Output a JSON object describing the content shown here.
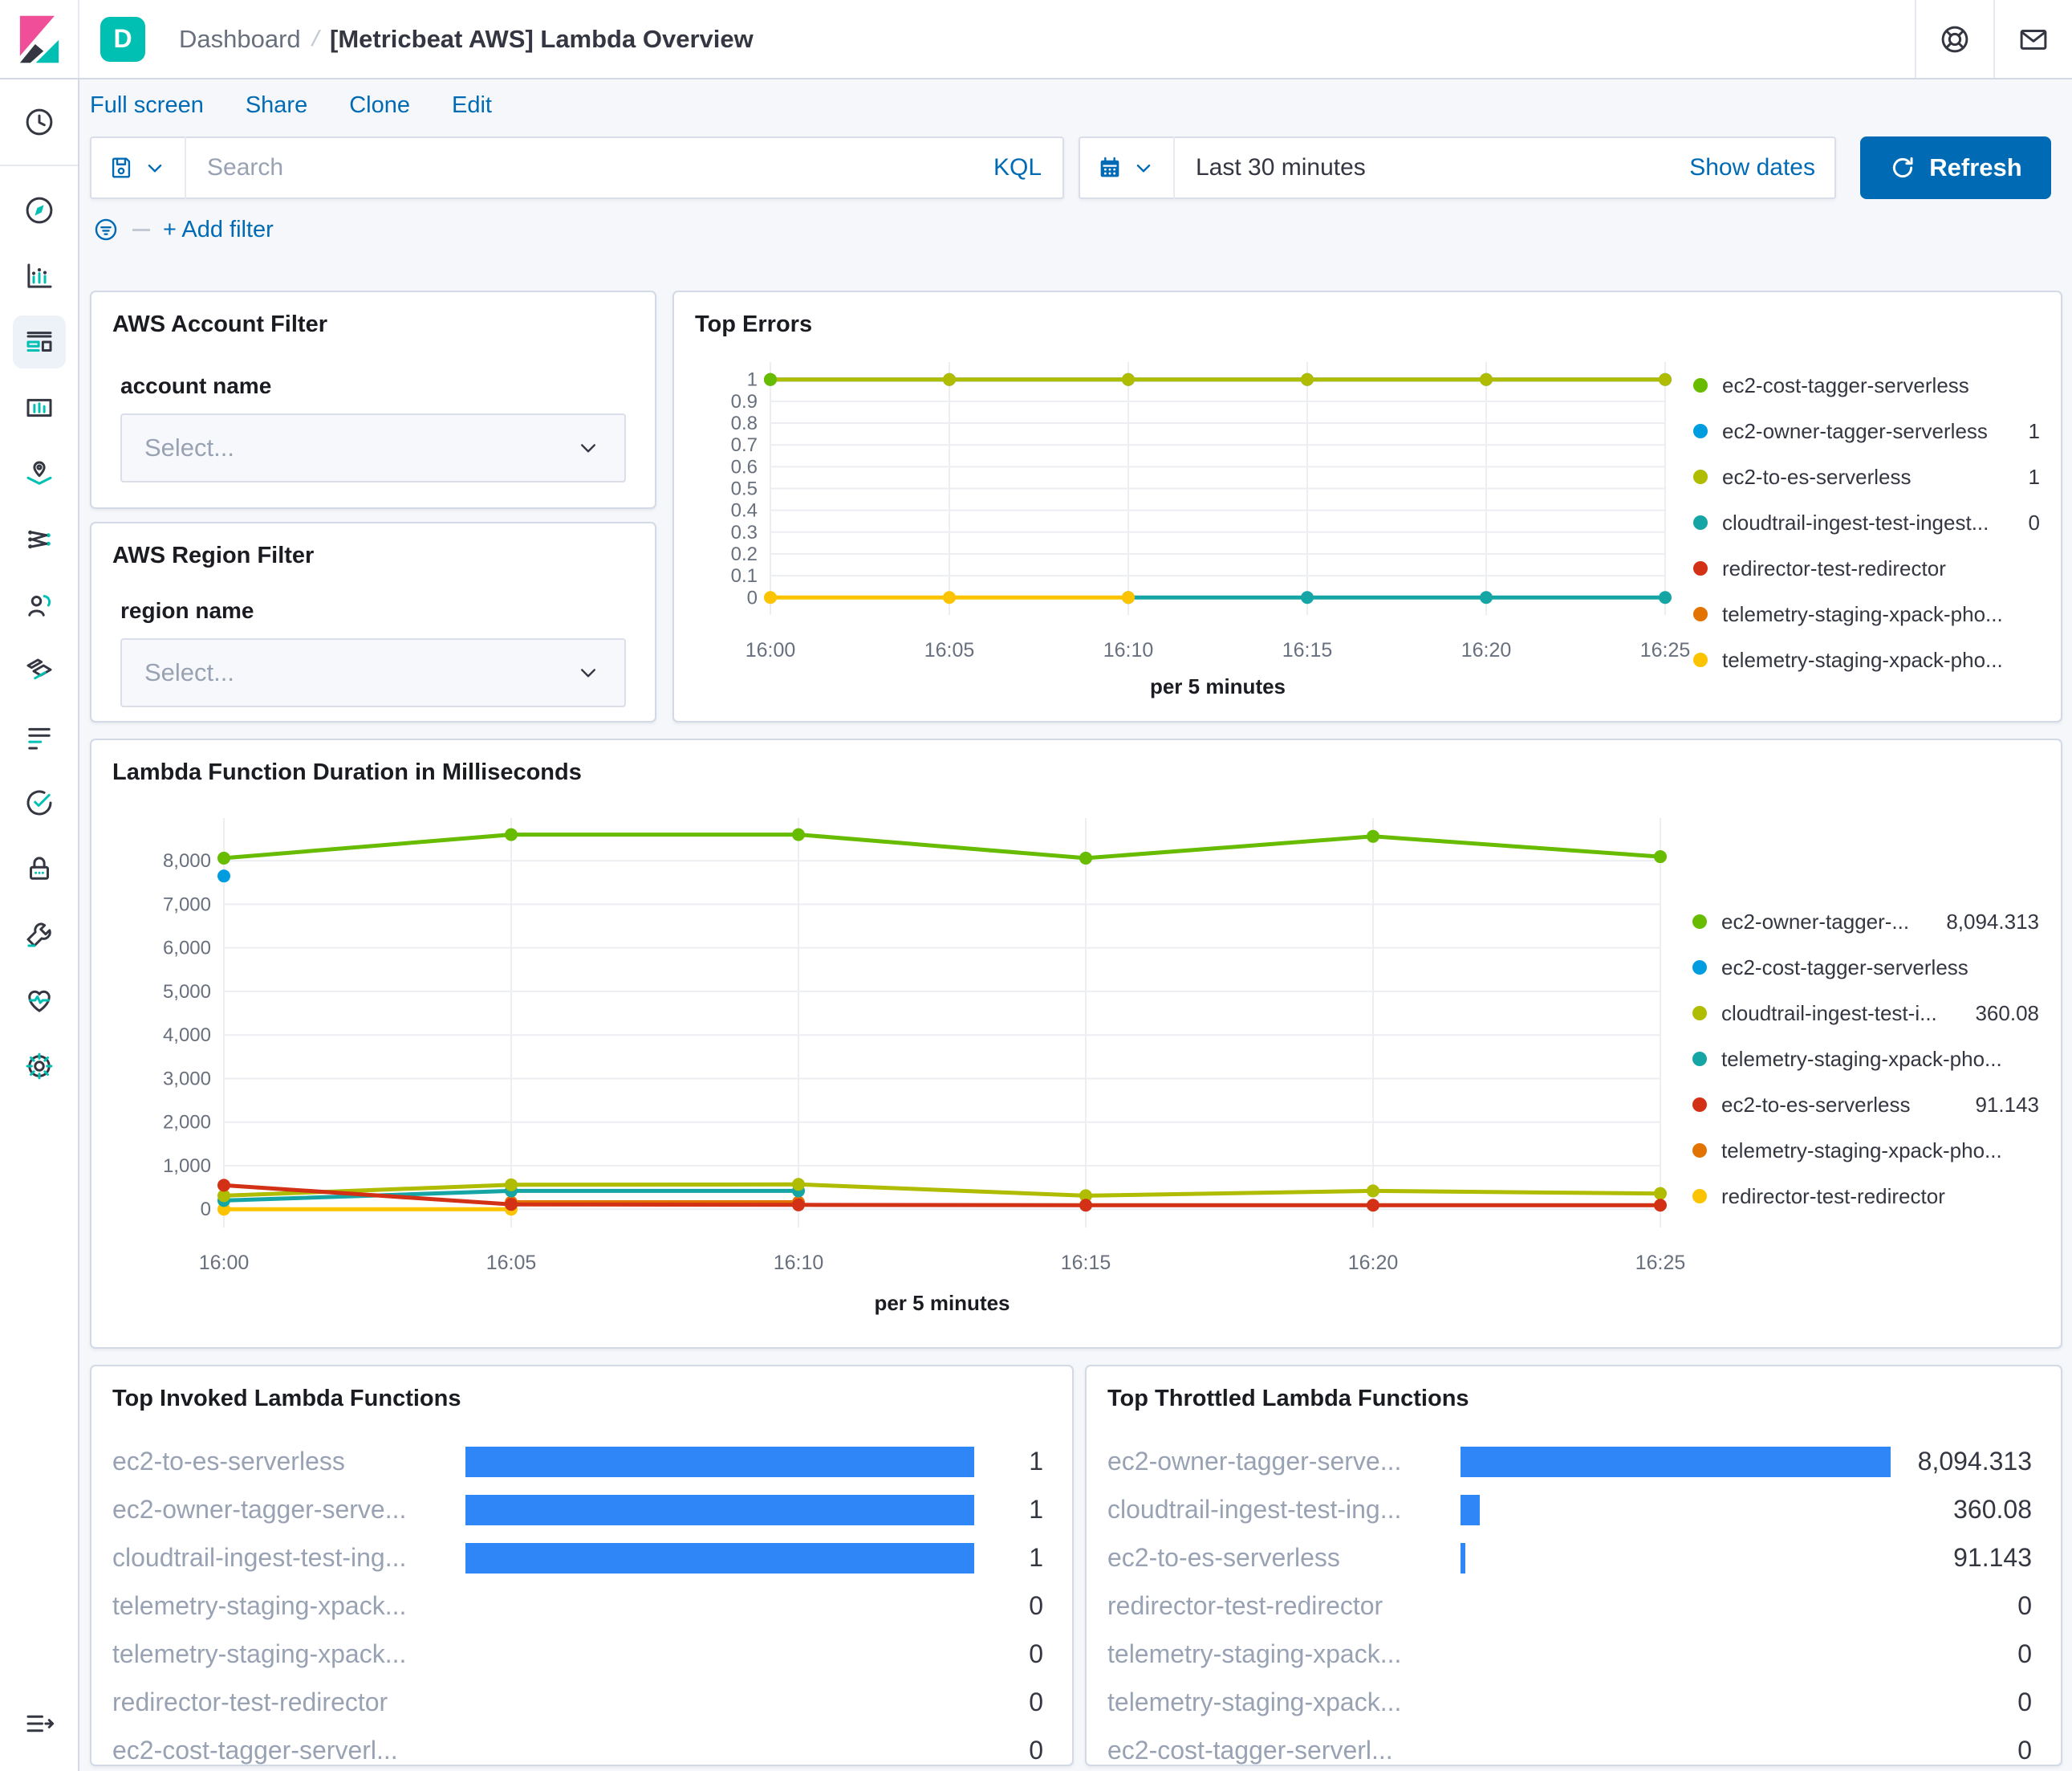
{
  "header": {
    "badge": "D",
    "breadcrumb_prev": "Dashboard",
    "breadcrumb_current": "[Metricbeat AWS] Lambda Overview"
  },
  "toolbar": {
    "links": [
      "Full screen",
      "Share",
      "Clone",
      "Edit"
    ],
    "search_placeholder": "Search",
    "kql_label": "KQL",
    "time_range": "Last 30 minutes",
    "show_dates_label": "Show dates",
    "refresh_label": "Refresh",
    "add_filter_label": "+ Add filter"
  },
  "sidebar": {
    "top": [
      {
        "icon": "clock",
        "name": "recently-viewed"
      }
    ],
    "apps": [
      {
        "icon": "discover",
        "name": "discover",
        "active": false
      },
      {
        "icon": "visualize",
        "name": "visualize",
        "active": false
      },
      {
        "icon": "dashboard",
        "name": "dashboard",
        "active": true
      },
      {
        "icon": "canvas",
        "name": "canvas",
        "active": false
      },
      {
        "icon": "maps",
        "name": "maps",
        "active": false
      },
      {
        "icon": "ml",
        "name": "machine-learning",
        "active": false
      },
      {
        "icon": "apm",
        "name": "apm",
        "active": false
      },
      {
        "icon": "infrastructure",
        "name": "infrastructure",
        "active": false
      },
      {
        "icon": "logs",
        "name": "logs",
        "active": false
      },
      {
        "icon": "uptime",
        "name": "uptime",
        "active": false
      },
      {
        "icon": "siem",
        "name": "siem",
        "active": false
      },
      {
        "icon": "devtools",
        "name": "dev-tools",
        "active": false
      },
      {
        "icon": "monitoring",
        "name": "stack-monitoring",
        "active": false
      },
      {
        "icon": "management",
        "name": "management",
        "active": false
      }
    ],
    "bottom": [
      {
        "icon": "collapse",
        "name": "collapse-navigation"
      }
    ]
  },
  "account_filter": {
    "title": "AWS Account Filter",
    "label": "account name",
    "placeholder": "Select..."
  },
  "region_filter": {
    "title": "AWS Region Filter",
    "label": "region name",
    "placeholder": "Select..."
  },
  "colors": {
    "accent_blue": "#006BB4",
    "badge_teal": "#00BFB3",
    "table_bar_blue": "#2F86F7",
    "palette": [
      "#68BC00",
      "#009CE0",
      "#B0BC00",
      "#16A5A5",
      "#D33115",
      "#E27300",
      "#FCC400"
    ]
  },
  "chart_data": [
    {
      "id": "top_errors",
      "type": "line",
      "title": "Top Errors",
      "x": [
        "16:00",
        "16:05",
        "16:10",
        "16:15",
        "16:20",
        "16:25"
      ],
      "xlabel": "per 5 minutes",
      "ylim": [
        -0.08,
        1.08
      ],
      "yticks": [
        0,
        0.1,
        0.2,
        0.3,
        0.4,
        0.5,
        0.6,
        0.7,
        0.8,
        0.9,
        1
      ],
      "ylabels": [
        "0",
        "0.1",
        "0.2",
        "0.3",
        "0.4",
        "0.5",
        "0.6",
        "0.7",
        "0.8",
        "0.9",
        "1"
      ],
      "grid": true,
      "legend_position": "right",
      "series": [
        {
          "name": "ec2-cost-tagger-serverless",
          "color": "#68BC00",
          "values": [
            1,
            null,
            null,
            null,
            null,
            null
          ]
        },
        {
          "name": "ec2-owner-tagger-serverless",
          "color": "#009CE0",
          "values": [
            1,
            1,
            1,
            1,
            1,
            1
          ]
        },
        {
          "name": "ec2-to-es-serverless",
          "color": "#B0BC00",
          "values": [
            1,
            1,
            1,
            1,
            1,
            1
          ]
        },
        {
          "name": "cloudtrail-ingest-test-ingest...",
          "color": "#16A5A5",
          "values": [
            null,
            null,
            0,
            0,
            0,
            0
          ]
        },
        {
          "name": "redirector-test-redirector",
          "color": "#D33115",
          "values": [
            null,
            null,
            null,
            null,
            null,
            null
          ]
        },
        {
          "name": "telemetry-staging-xpack-pho...",
          "color": "#E27300",
          "values": [
            null,
            null,
            null,
            null,
            null,
            null
          ]
        },
        {
          "name": "telemetry-staging-xpack-pho...",
          "color": "#FCC400",
          "values": [
            0,
            0,
            0,
            null,
            null,
            null
          ]
        }
      ],
      "draw_order": [
        1,
        2,
        3,
        5,
        4,
        6,
        0
      ],
      "legend": [
        {
          "label": "ec2-cost-tagger-serverless",
          "color": "#68BC00",
          "value": ""
        },
        {
          "label": "ec2-owner-tagger-serverless",
          "color": "#009CE0",
          "value": "1"
        },
        {
          "label": "ec2-to-es-serverless",
          "color": "#B0BC00",
          "value": "1"
        },
        {
          "label": "cloudtrail-ingest-test-ingest...",
          "color": "#16A5A5",
          "value": "0"
        },
        {
          "label": "redirector-test-redirector",
          "color": "#D33115",
          "value": ""
        },
        {
          "label": "telemetry-staging-xpack-pho...",
          "color": "#E27300",
          "value": ""
        },
        {
          "label": "telemetry-staging-xpack-pho...",
          "color": "#FCC400",
          "value": ""
        }
      ]
    },
    {
      "id": "lambda_duration",
      "type": "line",
      "title": "Lambda Function Duration in Milliseconds",
      "x": [
        "16:00",
        "16:05",
        "16:10",
        "16:15",
        "16:20",
        "16:25"
      ],
      "xlabel": "per 5 minutes",
      "ylim": [
        -420,
        8980
      ],
      "yticks": [
        0,
        1000,
        2000,
        3000,
        4000,
        5000,
        6000,
        7000,
        8000
      ],
      "ylabels": [
        "0",
        "1,000",
        "2,000",
        "3,000",
        "4,000",
        "5,000",
        "6,000",
        "7,000",
        "8,000"
      ],
      "grid": true,
      "legend_position": "right",
      "series": [
        {
          "name": "ec2-owner-tagger-serverless",
          "color": "#68BC00",
          "values": [
            8060,
            8600,
            8600,
            8060,
            8560,
            8094.313
          ]
        },
        {
          "name": "ec2-cost-tagger-serverless",
          "color": "#009CE0",
          "values": [
            7650,
            null,
            null,
            null,
            null,
            null
          ]
        },
        {
          "name": "cloudtrail-ingest-test-ingest",
          "color": "#B0BC00",
          "values": [
            310,
            560,
            570,
            310,
            420,
            360.08
          ]
        },
        {
          "name": "telemetry-staging-xpack-phone-home",
          "color": "#16A5A5",
          "values": [
            200,
            420,
            420,
            null,
            null,
            null
          ]
        },
        {
          "name": "ec2-to-es-serverless",
          "color": "#D33115",
          "values": [
            550,
            110,
            100,
            91,
            91,
            91.143
          ]
        },
        {
          "name": "telemetry-staging-xpack-phone-home",
          "color": "#E27300",
          "values": [
            null,
            160,
            160,
            null,
            null,
            null
          ]
        },
        {
          "name": "redirector-test-redirector",
          "color": "#FCC400",
          "values": [
            0,
            0,
            null,
            null,
            null,
            null
          ]
        }
      ],
      "draw_order": [
        6,
        5,
        3,
        2,
        4,
        1,
        0
      ],
      "legend": [
        {
          "label": "ec2-owner-tagger-...",
          "color": "#68BC00",
          "value": "8,094.313"
        },
        {
          "label": "ec2-cost-tagger-serverless",
          "color": "#009CE0",
          "value": ""
        },
        {
          "label": "cloudtrail-ingest-test-i...",
          "color": "#B0BC00",
          "value": "360.08"
        },
        {
          "label": "telemetry-staging-xpack-pho...",
          "color": "#16A5A5",
          "value": ""
        },
        {
          "label": "ec2-to-es-serverless",
          "color": "#D33115",
          "value": "91.143"
        },
        {
          "label": "telemetry-staging-xpack-pho...",
          "color": "#E27300",
          "value": ""
        },
        {
          "label": "redirector-test-redirector",
          "color": "#FCC400",
          "value": ""
        }
      ]
    },
    {
      "id": "top_invoked",
      "type": "bar",
      "title": "Top Invoked Lambda Functions",
      "bar_color": "#2F86F7",
      "rows": [
        {
          "label": "ec2-to-es-serverless",
          "value": 1,
          "display": "1"
        },
        {
          "label": "ec2-owner-tagger-serve...",
          "value": 1,
          "display": "1"
        },
        {
          "label": "cloudtrail-ingest-test-ing...",
          "value": 1,
          "display": "1"
        },
        {
          "label": "telemetry-staging-xpack...",
          "value": 0,
          "display": "0"
        },
        {
          "label": "telemetry-staging-xpack...",
          "value": 0,
          "display": "0"
        },
        {
          "label": "redirector-test-redirector",
          "value": 0,
          "display": "0"
        },
        {
          "label": "ec2-cost-tagger-serverl...",
          "value": 0,
          "display": "0"
        }
      ]
    },
    {
      "id": "top_throttled",
      "type": "bar",
      "title": "Top Throttled Lambda Functions",
      "bar_color": "#2F86F7",
      "rows": [
        {
          "label": "ec2-owner-tagger-serve...",
          "value": 8094.313,
          "display": "8,094.313"
        },
        {
          "label": "cloudtrail-ingest-test-ing...",
          "value": 360.08,
          "display": "360.08"
        },
        {
          "label": "ec2-to-es-serverless",
          "value": 91.143,
          "display": "91.143"
        },
        {
          "label": "redirector-test-redirector",
          "value": 0,
          "display": "0"
        },
        {
          "label": "telemetry-staging-xpack...",
          "value": 0,
          "display": "0"
        },
        {
          "label": "telemetry-staging-xpack...",
          "value": 0,
          "display": "0"
        },
        {
          "label": "ec2-cost-tagger-serverl...",
          "value": 0,
          "display": "0"
        }
      ]
    }
  ]
}
